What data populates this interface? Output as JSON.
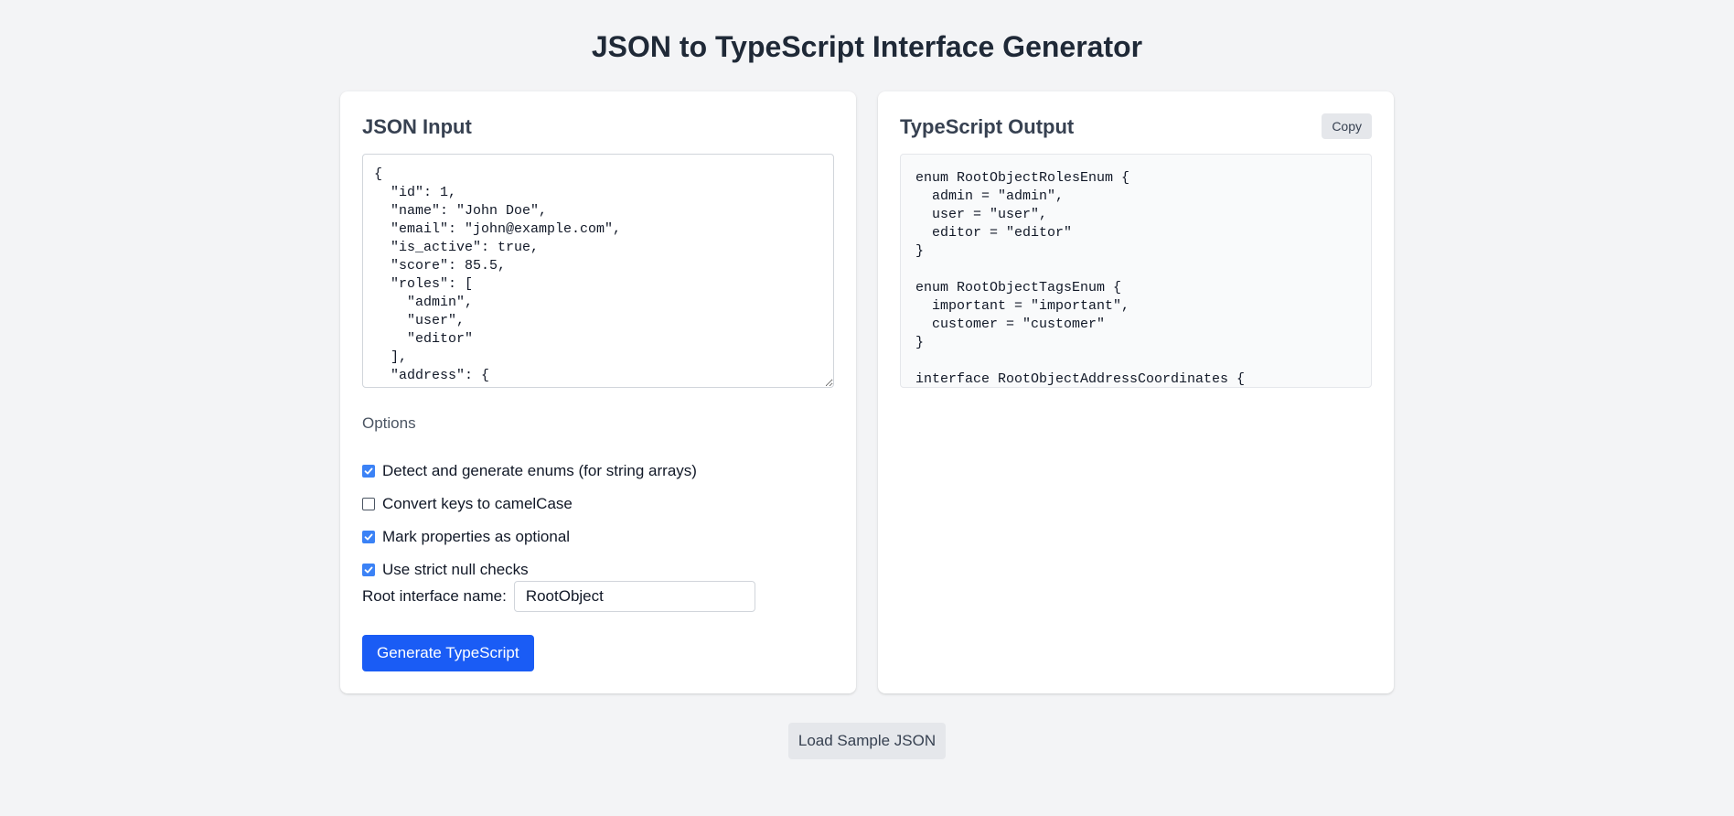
{
  "page": {
    "title": "JSON to TypeScript Interface Generator"
  },
  "input_panel": {
    "heading": "JSON Input",
    "json_text": "{\n  \"id\": 1,\n  \"name\": \"John Doe\",\n  \"email\": \"john@example.com\",\n  \"is_active\": true,\n  \"score\": 85.5,\n  \"roles\": [\n    \"admin\",\n    \"user\",\n    \"editor\"\n  ],\n  \"address\": {",
    "options_label": "Options",
    "options": [
      {
        "label": "Detect and generate enums (for string arrays)",
        "checked": true
      },
      {
        "label": "Convert keys to camelCase",
        "checked": false
      },
      {
        "label": "Mark properties as optional",
        "checked": true
      },
      {
        "label": "Use strict null checks",
        "checked": true
      }
    ],
    "root_name_label": "Root interface name:",
    "root_name_value": "RootObject",
    "generate_label": "Generate TypeScript"
  },
  "output_panel": {
    "heading": "TypeScript Output",
    "copy_label": "Copy",
    "output_text": "enum RootObjectRolesEnum {\n  admin = \"admin\",\n  user = \"user\",\n  editor = \"editor\"\n}\n\nenum RootObjectTagsEnum {\n  important = \"important\",\n  customer = \"customer\"\n}\n\ninterface RootObjectAddressCoordinates {"
  },
  "footer": {
    "load_sample_label": "Load Sample JSON"
  },
  "colors": {
    "accent": "#1a5cf5",
    "checkbox_checked": "#3b82f6",
    "page_background": "#f3f4f6"
  }
}
